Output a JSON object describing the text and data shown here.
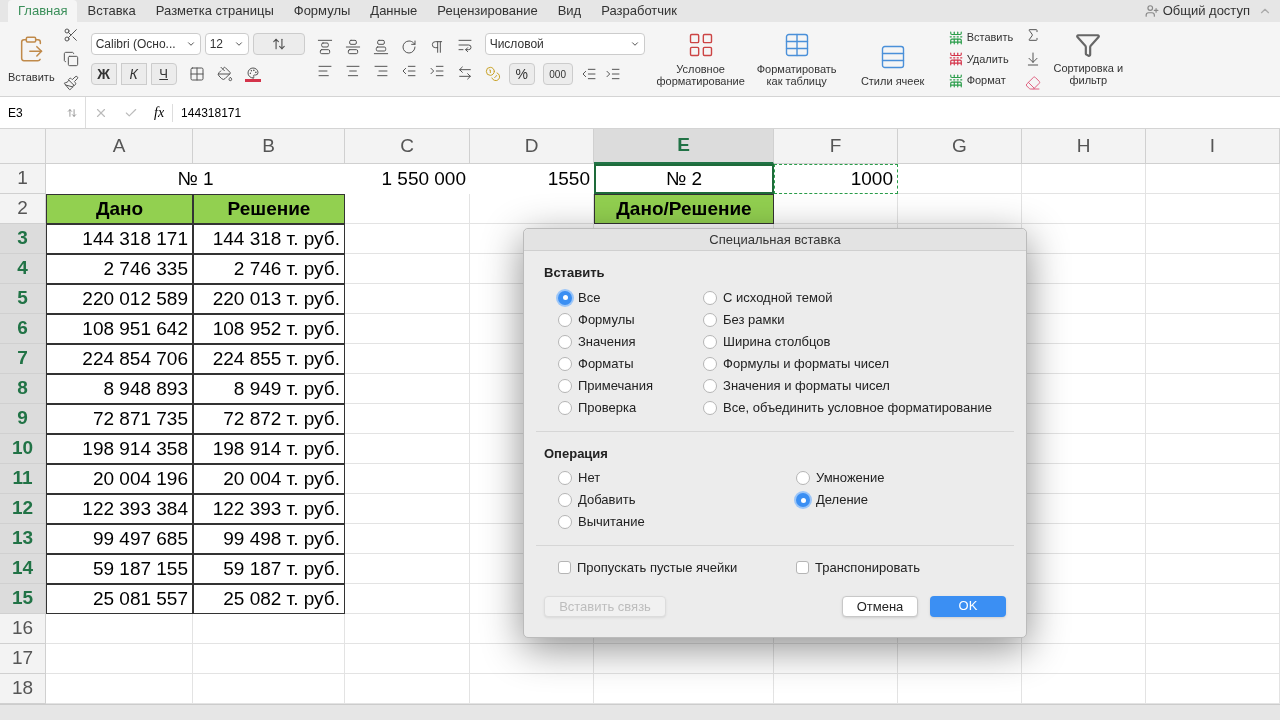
{
  "ribbon_tabs": [
    {
      "label": "Главная",
      "selected": true
    },
    {
      "label": "Вставка",
      "selected": false
    },
    {
      "label": "Разметка страницы",
      "selected": false
    },
    {
      "label": "Формулы",
      "selected": false
    },
    {
      "label": "Данные",
      "selected": false
    },
    {
      "label": "Рецензирование",
      "selected": false
    },
    {
      "label": "Вид",
      "selected": false
    },
    {
      "label": "Разработчик",
      "selected": false
    }
  ],
  "share_button": "Общий доступ",
  "ribbon": {
    "paste_label": "Вставить",
    "font_name": "Calibri (Осно...",
    "font_size": "12",
    "bold": "Ж",
    "italic": "К",
    "underline": "Ч",
    "number_format": "Числовой",
    "percent": "%",
    "thousands": "000",
    "styles": [
      "Условное форматирование",
      "Форматировать как таблицу",
      "Стили ячеек"
    ],
    "cells": [
      "Вставить",
      "Удалить",
      "Формат"
    ],
    "sort": "Сортировка и фильтр"
  },
  "formula_bar": {
    "cell_ref": "E3",
    "fx": "fx",
    "formula": "144318171"
  },
  "columns": [
    {
      "label": "A",
      "selected": false
    },
    {
      "label": "B",
      "selected": false
    },
    {
      "label": "C",
      "selected": false
    },
    {
      "label": "D",
      "selected": false
    },
    {
      "label": "E",
      "selected": true
    },
    {
      "label": "F",
      "selected": false
    },
    {
      "label": "G",
      "selected": false
    },
    {
      "label": "H",
      "selected": false
    },
    {
      "label": "I",
      "selected": false
    }
  ],
  "rows": [
    {
      "number": "1",
      "selected": false,
      "cells": [
        {
          "text": "№ 1",
          "kind": "title"
        },
        {
          "text": "1 550 000",
          "kind": "plain"
        },
        {
          "text": "1550",
          "kind": "plain"
        },
        {
          "text": "№ 2",
          "kind": "framed_title"
        },
        {
          "text": "1000",
          "kind": "copied"
        }
      ]
    },
    {
      "number": "2",
      "selected": false,
      "cells": [
        {
          "text": "Дано",
          "kind": "header"
        },
        {
          "text": "Решение",
          "kind": "header"
        },
        null,
        null,
        {
          "text": "Дано/Решение",
          "kind": "header"
        }
      ]
    },
    {
      "number": "3",
      "selected": true,
      "cells": [
        {
          "text": "144 318 171",
          "kind": "number"
        },
        {
          "text": "144 318 т. руб.",
          "kind": "number"
        }
      ]
    },
    {
      "number": "4",
      "selected": true,
      "cells": [
        {
          "text": "2 746 335",
          "kind": "number"
        },
        {
          "text": "2 746 т. руб.",
          "kind": "number"
        }
      ]
    },
    {
      "number": "5",
      "selected": true,
      "cells": [
        {
          "text": "220 012 589",
          "kind": "number"
        },
        {
          "text": "220 013 т. руб.",
          "kind": "number"
        }
      ]
    },
    {
      "number": "6",
      "selected": true,
      "cells": [
        {
          "text": "108 951 642",
          "kind": "number"
        },
        {
          "text": "108 952 т. руб.",
          "kind": "number"
        }
      ]
    },
    {
      "number": "7",
      "selected": true,
      "cells": [
        {
          "text": "224 854 706",
          "kind": "number"
        },
        {
          "text": "224 855 т. руб.",
          "kind": "number"
        }
      ]
    },
    {
      "number": "8",
      "selected": true,
      "cells": [
        {
          "text": "8 948 893",
          "kind": "number"
        },
        {
          "text": "8 949 т. руб.",
          "kind": "number"
        }
      ]
    },
    {
      "number": "9",
      "selected": true,
      "cells": [
        {
          "text": "72 871 735",
          "kind": "number"
        },
        {
          "text": "72 872 т. руб.",
          "kind": "number"
        }
      ]
    },
    {
      "number": "10",
      "selected": true,
      "cells": [
        {
          "text": "198 914 358",
          "kind": "number"
        },
        {
          "text": "198 914 т. руб.",
          "kind": "number"
        }
      ]
    },
    {
      "number": "11",
      "selected": true,
      "cells": [
        {
          "text": "20 004 196",
          "kind": "number"
        },
        {
          "text": "20 004 т. руб.",
          "kind": "number"
        }
      ]
    },
    {
      "number": "12",
      "selected": true,
      "cells": [
        {
          "text": "122 393 384",
          "kind": "number"
        },
        {
          "text": "122 393 т. руб.",
          "kind": "number"
        }
      ]
    },
    {
      "number": "13",
      "selected": true,
      "cells": [
        {
          "text": "99 497 685",
          "kind": "number"
        },
        {
          "text": "99 498 т. руб.",
          "kind": "number"
        }
      ]
    },
    {
      "number": "14",
      "selected": true,
      "cells": [
        {
          "text": "59 187 155",
          "kind": "number"
        },
        {
          "text": "59 187 т. руб.",
          "kind": "number"
        }
      ]
    },
    {
      "number": "15",
      "selected": true,
      "cells": [
        {
          "text": "25 081 557",
          "kind": "number"
        },
        {
          "text": "25 082 т. руб.",
          "kind": "number"
        }
      ]
    },
    {
      "number": "16",
      "selected": false,
      "cells": []
    },
    {
      "number": "17",
      "selected": false,
      "cells": []
    },
    {
      "number": "18",
      "selected": false,
      "cells": []
    }
  ],
  "dialog": {
    "title": "Специальная вставка",
    "paste": {
      "title": "Вставить",
      "options": [
        {
          "label": "Все",
          "selected": true
        },
        {
          "label": "Формулы",
          "selected": false
        },
        {
          "label": "Значения",
          "selected": false
        },
        {
          "label": "Форматы",
          "selected": false
        },
        {
          "label": "Примечания",
          "selected": false
        },
        {
          "label": "Проверка",
          "selected": false
        },
        {
          "label": "С исходной темой",
          "selected": false
        },
        {
          "label": "Без рамки",
          "selected": false
        },
        {
          "label": "Ширина столбцов",
          "selected": false
        },
        {
          "label": "Формулы и форматы чисел",
          "selected": false
        },
        {
          "label": "Значения и форматы чисел",
          "selected": false
        },
        {
          "label": "Все, объединить условное форматирование",
          "selected": false
        }
      ]
    },
    "operation": {
      "title": "Операция",
      "options": [
        {
          "label": "Нет",
          "selected": false
        },
        {
          "label": "Добавить",
          "selected": false
        },
        {
          "label": "Вычитание",
          "selected": false
        },
        {
          "label": "Умножение",
          "selected": false
        },
        {
          "label": "Деление",
          "selected": true
        }
      ]
    },
    "checkboxes": [
      {
        "label": "Пропускать пустые ячейки",
        "checked": false
      },
      {
        "label": "Транспонировать",
        "checked": false
      }
    ],
    "buttons": [
      {
        "label": "Вставить связь",
        "kind": "link",
        "disabled": true
      },
      {
        "label": "Отмена",
        "kind": "secondary",
        "disabled": false
      },
      {
        "label": "OK",
        "kind": "primary",
        "disabled": false
      }
    ]
  }
}
